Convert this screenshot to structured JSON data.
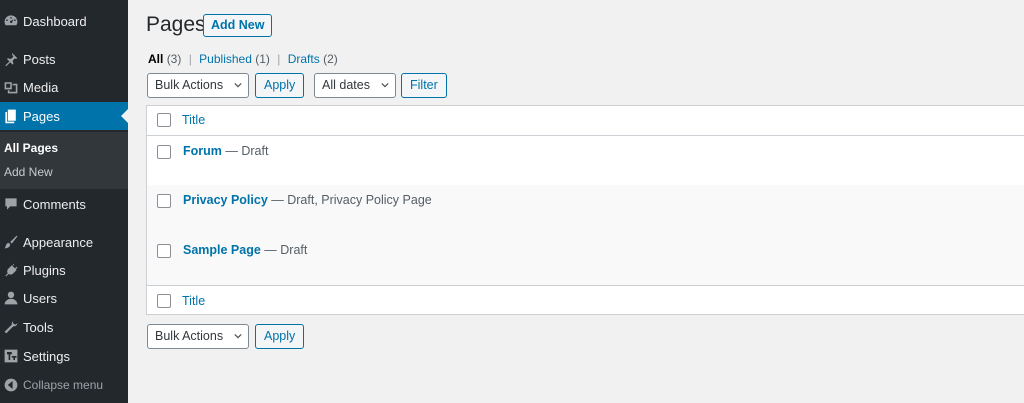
{
  "sidebar": {
    "items": [
      {
        "label": "Dashboard",
        "icon": "dashboard-icon"
      },
      {
        "label": "Posts",
        "icon": "pin-icon"
      },
      {
        "label": "Media",
        "icon": "media-icon"
      },
      {
        "label": "Pages",
        "icon": "pages-icon"
      },
      {
        "label": "Comments",
        "icon": "comment-icon"
      },
      {
        "label": "Appearance",
        "icon": "brush-icon"
      },
      {
        "label": "Plugins",
        "icon": "plug-icon"
      },
      {
        "label": "Users",
        "icon": "user-icon"
      },
      {
        "label": "Tools",
        "icon": "wrench-icon"
      },
      {
        "label": "Settings",
        "icon": "settings-icon"
      }
    ],
    "active": "Pages",
    "submenu": [
      {
        "label": "All Pages",
        "current": true
      },
      {
        "label": "Add New",
        "current": false
      }
    ],
    "collapse_label": "Collapse menu"
  },
  "header": {
    "title": "Pages",
    "add_new_label": "Add New"
  },
  "filters": {
    "all_label": "All",
    "all_count": "(3)",
    "published_label": "Published",
    "published_count": "(1)",
    "drafts_label": "Drafts",
    "drafts_count": "(2)",
    "separator": "|"
  },
  "toolbar_top": {
    "bulk_actions": "Bulk Actions",
    "apply": "Apply",
    "dates": "All dates",
    "filter": "Filter"
  },
  "table": {
    "column_title": "Title",
    "rows": [
      {
        "title": "Forum",
        "state": " — Draft"
      },
      {
        "title": "Privacy Policy",
        "state": " — Draft, Privacy Policy Page"
      },
      {
        "title": "Sample Page",
        "state": " — Draft"
      }
    ]
  },
  "toolbar_bottom": {
    "bulk_actions": "Bulk Actions",
    "apply": "Apply"
  },
  "colors": {
    "sidebar_bg": "#23282d",
    "accent": "#0073aa",
    "page_bg": "#f1f1f1"
  }
}
